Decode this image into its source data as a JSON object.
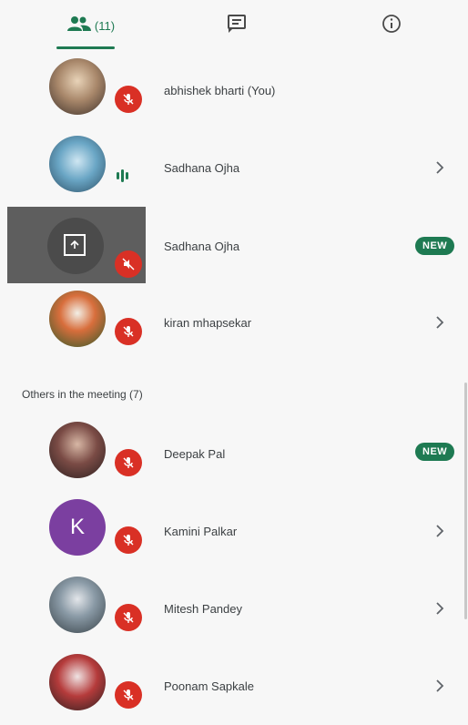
{
  "tabs": {
    "people_count": "(11)"
  },
  "participants": [
    {
      "name": "abhishek bharti (You)"
    },
    {
      "name": "Sadhana Ojha"
    },
    {
      "name": "Sadhana Ojha",
      "badge": "NEW"
    },
    {
      "name": "kiran mhapsekar"
    }
  ],
  "others": {
    "heading": "Others in the meeting (7)",
    "items": [
      {
        "name": "Deepak Pal",
        "badge": "NEW"
      },
      {
        "name": "Kamini Palkar",
        "initial": "K"
      },
      {
        "name": "Mitesh Pandey"
      },
      {
        "name": "Poonam Sapkale"
      }
    ]
  },
  "colors": {
    "accent": "#1e7a52",
    "muted_mic": "#d93025",
    "avatar_k": "#7b3fa0"
  }
}
